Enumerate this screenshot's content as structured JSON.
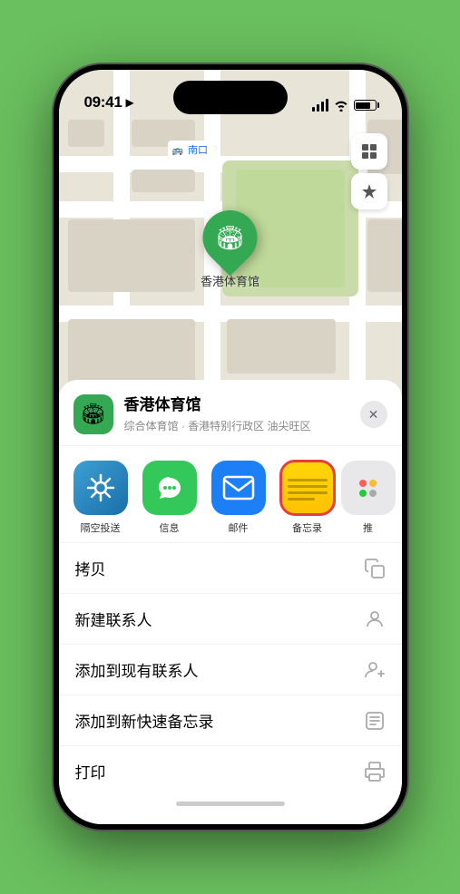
{
  "status": {
    "time": "09:41",
    "location_arrow": "▶"
  },
  "map": {
    "label": "南口",
    "pin_emoji": "🏟",
    "place_name": "香港体育馆",
    "place_subtitle": "综合体育馆 · 香港特别行政区 油尖旺区"
  },
  "share": {
    "items": [
      {
        "id": "airdrop",
        "label": "隔空投送",
        "emoji": "📡"
      },
      {
        "id": "messages",
        "label": "信息",
        "emoji": "💬"
      },
      {
        "id": "mail",
        "label": "邮件",
        "emoji": "✉️"
      },
      {
        "id": "notes",
        "label": "备忘录",
        "emoji": ""
      },
      {
        "id": "more",
        "label": "推",
        "emoji": ""
      }
    ]
  },
  "actions": [
    {
      "label": "拷贝",
      "icon": "copy"
    },
    {
      "label": "新建联系人",
      "icon": "person"
    },
    {
      "label": "添加到现有联系人",
      "icon": "person-add"
    },
    {
      "label": "添加到新快速备忘录",
      "icon": "note"
    },
    {
      "label": "打印",
      "icon": "printer"
    }
  ],
  "buttons": {
    "close": "✕"
  }
}
